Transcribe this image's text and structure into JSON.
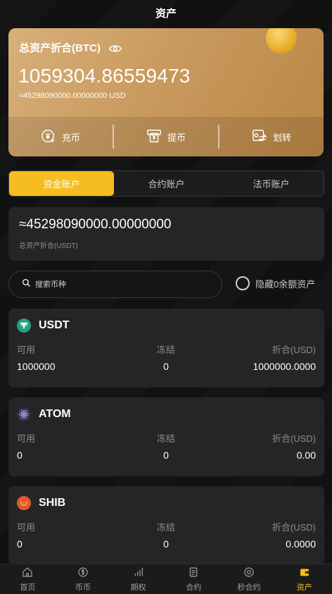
{
  "header": {
    "title": "资产"
  },
  "hero": {
    "title": "总资产折合(BTC)",
    "balance": "1059304.86559473",
    "usd": "≈45298090000.00000000 USD",
    "actions": [
      {
        "label": "充币",
        "icon": "deposit-icon"
      },
      {
        "label": "提币",
        "icon": "withdraw-icon"
      },
      {
        "label": "划转",
        "icon": "transfer-icon"
      }
    ]
  },
  "tabs": [
    {
      "label": "资金账户",
      "active": true
    },
    {
      "label": "合约账户",
      "active": false
    },
    {
      "label": "法币账户",
      "active": false
    }
  ],
  "total": {
    "value": "≈45298090000.00000000",
    "label": "总资产折合(USDT)"
  },
  "search": {
    "placeholder": "搜索币种"
  },
  "hide_zero": {
    "label": "隐藏0余额资产"
  },
  "columns": {
    "available": "可用",
    "frozen": "冻结",
    "equiv": "折合(USD)"
  },
  "assets": [
    {
      "name": "USDT",
      "available": "1000000",
      "frozen": "0",
      "equiv": "1000000.0000",
      "color": "#26a17b"
    },
    {
      "name": "ATOM",
      "available": "0",
      "frozen": "0",
      "equiv": "0.00",
      "color": "#2e3148"
    },
    {
      "name": "SHIB",
      "available": "0",
      "frozen": "0",
      "equiv": "0.0000",
      "color": "#e4572e"
    }
  ],
  "nav": [
    {
      "label": "首页",
      "icon": "home-icon",
      "active": false
    },
    {
      "label": "币币",
      "icon": "coin-icon",
      "active": false
    },
    {
      "label": "期权",
      "icon": "bar-chart-icon",
      "active": false
    },
    {
      "label": "合约",
      "icon": "document-icon",
      "active": false
    },
    {
      "label": "秒合约",
      "icon": "target-icon",
      "active": false
    },
    {
      "label": "资产",
      "icon": "wallet-icon",
      "active": true
    }
  ],
  "accent_color": "#f5bd1f"
}
